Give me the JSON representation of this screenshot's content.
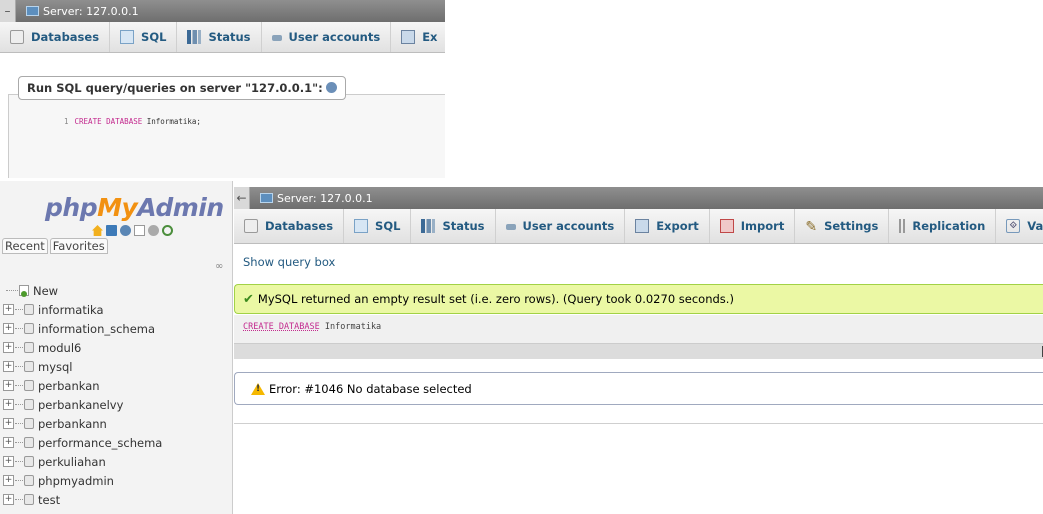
{
  "top_snippet": {
    "server_label": "Server: 127.0.0.1",
    "tabs": [
      "Databases",
      "SQL",
      "Status",
      "User accounts",
      "Ex"
    ],
    "legend": "Run SQL query/queries on server \"127.0.0.1\":",
    "sql_line_number": "1",
    "sql_keyword": "CREATE DATABASE",
    "sql_rest": " Informatika;"
  },
  "sidebar": {
    "logo": {
      "php": "php",
      "my": "My",
      "admin": "Admin"
    },
    "nav_tabs": [
      "Recent",
      "Favorites"
    ],
    "tree": [
      {
        "label": "New",
        "type": "new"
      },
      {
        "label": "informatika",
        "type": "db"
      },
      {
        "label": "information_schema",
        "type": "db"
      },
      {
        "label": "modul6",
        "type": "db"
      },
      {
        "label": "mysql",
        "type": "db"
      },
      {
        "label": "perbankan",
        "type": "db"
      },
      {
        "label": "perbankanelvy",
        "type": "db"
      },
      {
        "label": "perbankann",
        "type": "db"
      },
      {
        "label": "performance_schema",
        "type": "db"
      },
      {
        "label": "perkuliahan",
        "type": "db"
      },
      {
        "label": "phpmyadmin",
        "type": "db"
      },
      {
        "label": "test",
        "type": "db"
      }
    ]
  },
  "main": {
    "server_label": "Server: 127.0.0.1",
    "tabs": [
      "Databases",
      "SQL",
      "Status",
      "User accounts",
      "Export",
      "Import",
      "Settings",
      "Replication",
      "Variab"
    ],
    "show_query_box": "Show query box",
    "success_message": "MySQL returned an empty result set (i.e. zero rows). (Query took 0.0270 seconds.)",
    "sql_keyword": "CREATE DATABASE",
    "sql_rest": " Informatika",
    "error_message": "Error: #1046 No database selected"
  },
  "colors": {
    "logo_php": "#6c78af",
    "logo_my": "#f29111",
    "success_bg": "#ebf8a4",
    "success_border": "#a2d246",
    "tab_text": "#235a81",
    "sql_keyword": "#c32a8e"
  }
}
